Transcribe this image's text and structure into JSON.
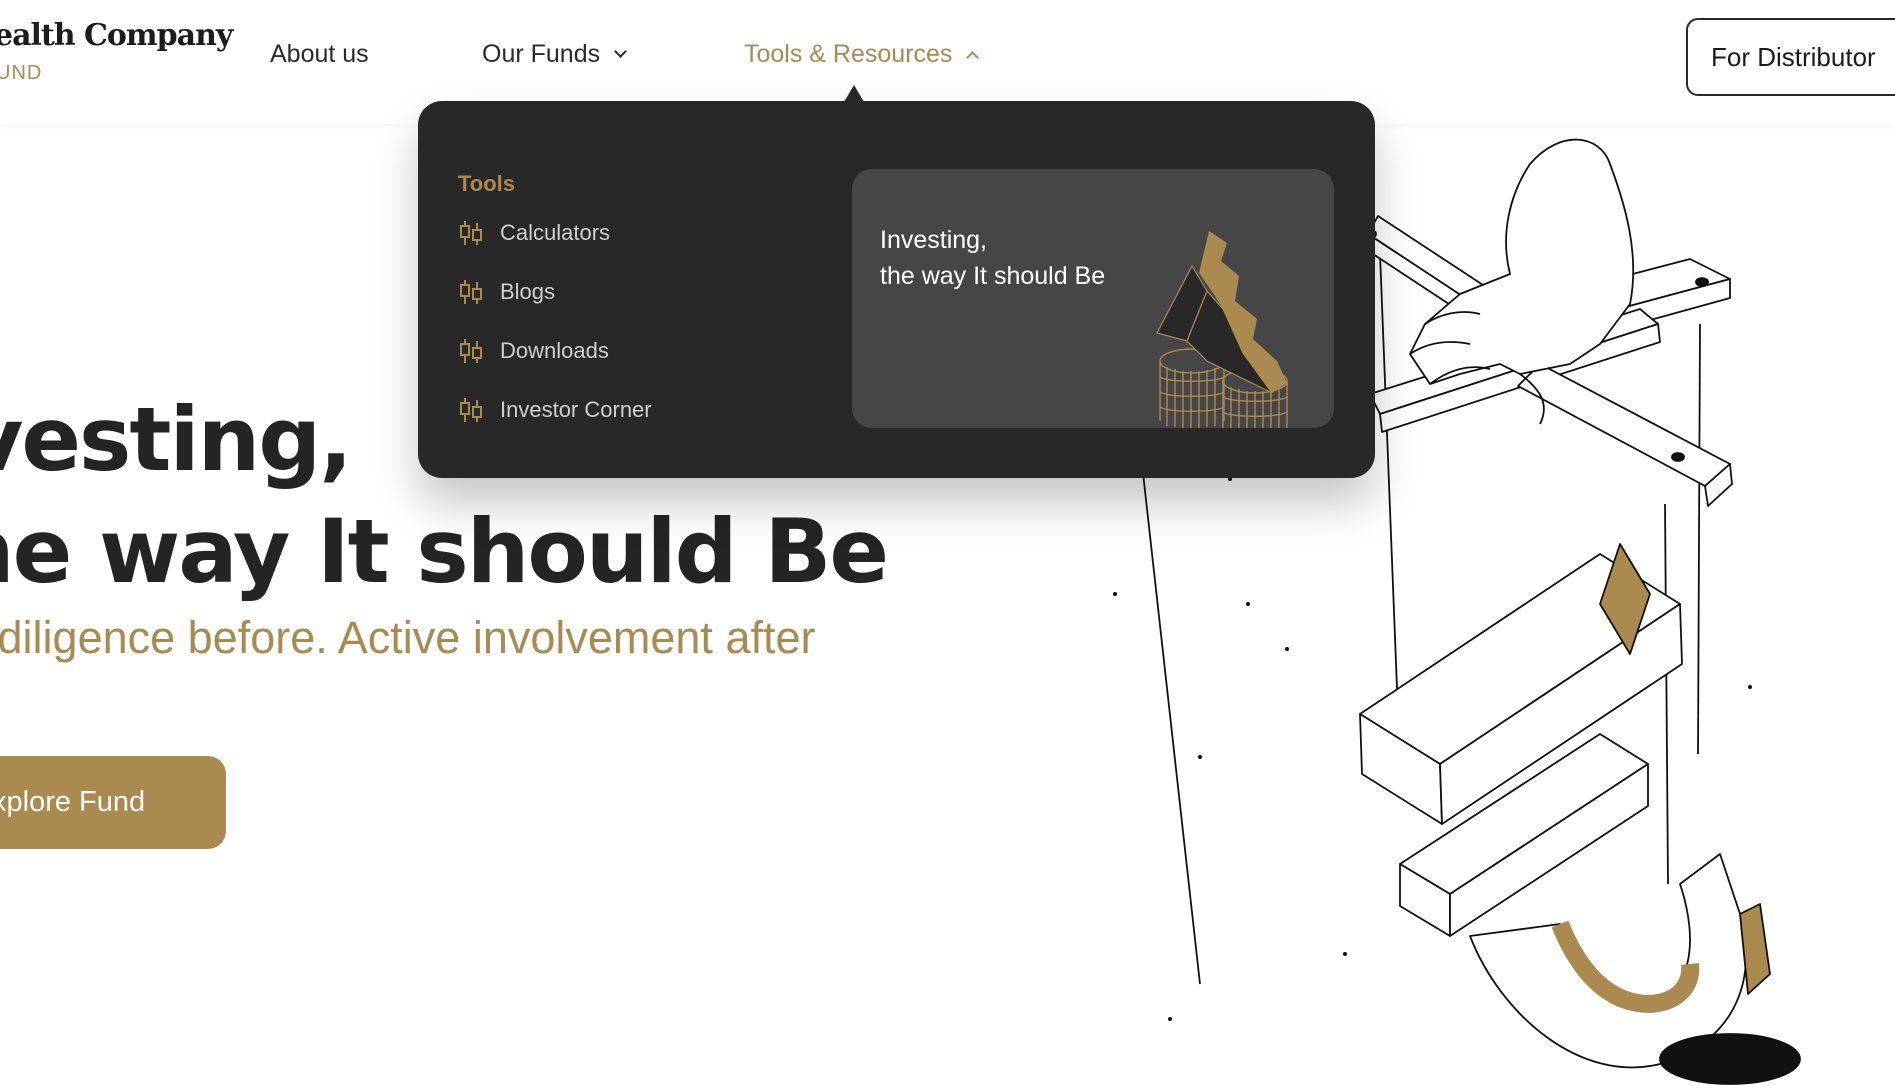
{
  "header": {
    "logo_title": "ealth Company",
    "logo_subtitle": "UND",
    "nav": [
      {
        "label": "About us"
      },
      {
        "label": "Our Funds"
      },
      {
        "label": "Tools & Resources"
      }
    ],
    "distributor_label": "For Distributor"
  },
  "dropdown": {
    "heading": "Tools",
    "items": [
      {
        "label": "Calculators",
        "icon": "candlestick-icon"
      },
      {
        "label": "Blogs",
        "icon": "candlestick-icon"
      },
      {
        "label": "Downloads",
        "icon": "candlestick-icon"
      },
      {
        "label": "Investor Corner",
        "icon": "candlestick-icon"
      }
    ],
    "promo": {
      "line1": "Investing,",
      "line2": "the way It should Be"
    }
  },
  "hero": {
    "line1": "vesting,",
    "line2": "ne way It should Be",
    "subtitle": "p diligence before. Active involvement after",
    "cta_label": "xplore Fund"
  },
  "colors": {
    "accent": "#ab8a4f",
    "dark": "#282828",
    "promo_bg": "#464646",
    "text": "#242424"
  }
}
